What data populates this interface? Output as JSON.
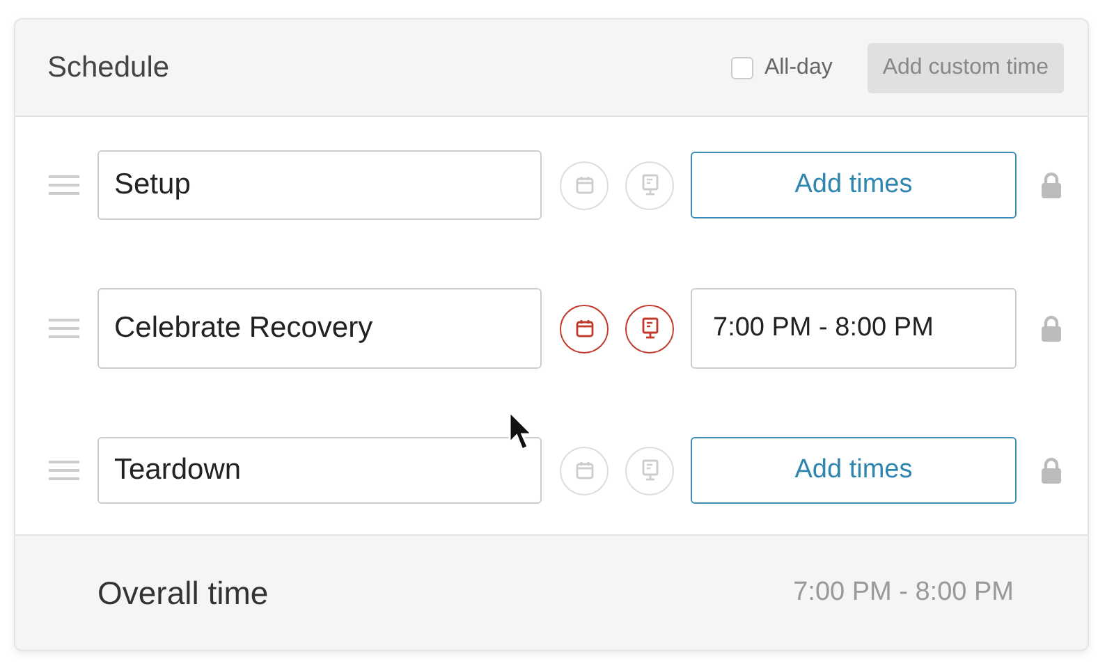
{
  "header": {
    "title": "Schedule",
    "all_day": {
      "label": "All-day",
      "checked": false
    },
    "custom_time_button": {
      "label": "Add custom time",
      "disabled": true
    }
  },
  "rows": [
    {
      "name": "Setup",
      "active": false,
      "kind": "button",
      "time": "Add times"
    },
    {
      "name": "Celebrate Recovery",
      "active": true,
      "kind": "time",
      "time": "7:00 PM - 8:00 PM"
    },
    {
      "name": "Teardown",
      "active": false,
      "kind": "button",
      "time": "Add times"
    }
  ],
  "footer": {
    "label": "Overall time",
    "value": "7:00 PM - 8:00 PM"
  }
}
